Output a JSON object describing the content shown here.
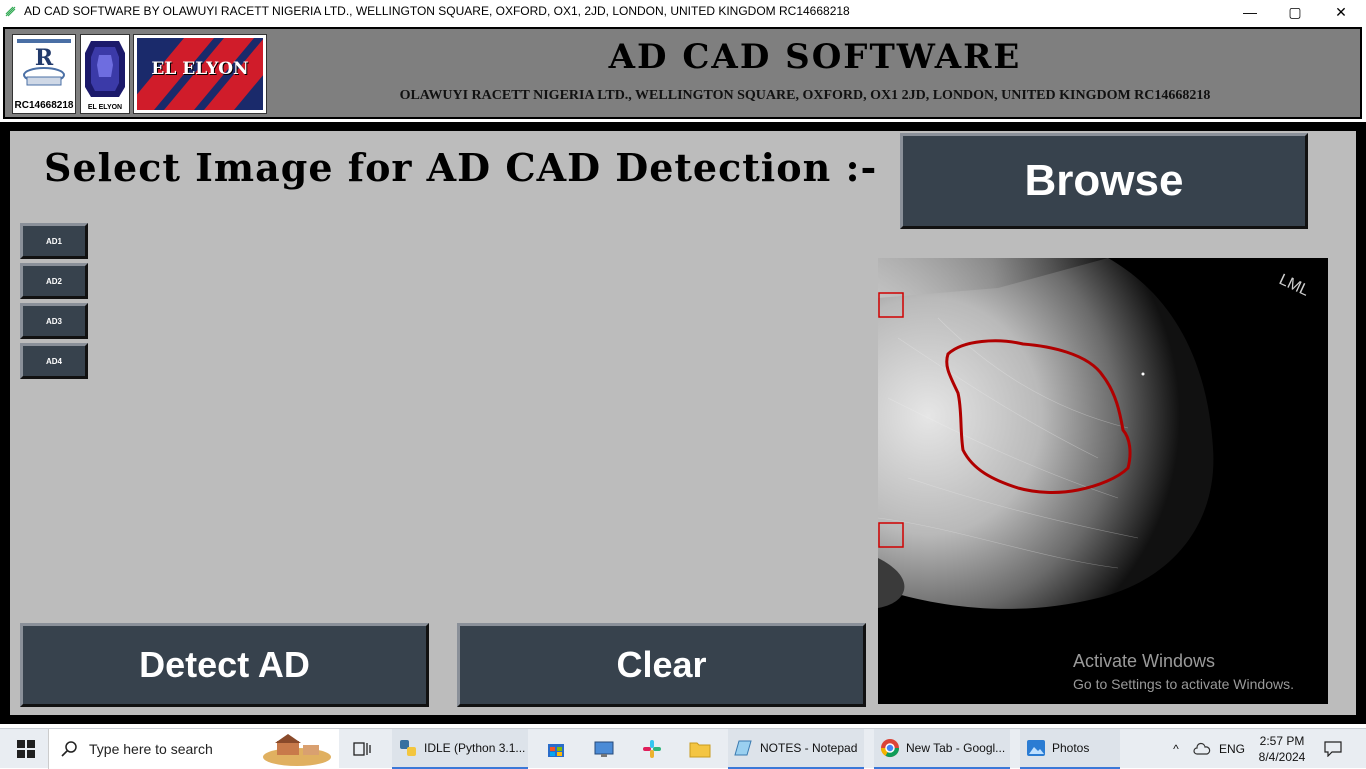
{
  "window": {
    "title": "AD CAD SOFTWARE BY OLAWUYI RACETT NIGERIA LTD., WELLINGTON SQUARE, OXFORD, OX1, 2JD, LONDON, UNITED KINGDOM RC14668218",
    "controls": {
      "minimize": "—",
      "maximize": "▢",
      "close": "✕"
    }
  },
  "header": {
    "title": "AD CAD SOFTWARE",
    "company_line": "OLAWUYI RACETT NIGERIA LTD., WELLINGTON SQUARE, OXFORD, OX1 2JD, LONDON, UNITED KINGDOM RC14668218",
    "logos": {
      "logo1_caption": "RC14668218",
      "logo2_caption": "EL ELYON",
      "logo3_text": "EL ELYON"
    }
  },
  "main": {
    "select_label": "Select Image for AD CAD Detection :-",
    "browse_label": "Browse",
    "ad_buttons": [
      "AD1",
      "AD2",
      "AD3",
      "AD4"
    ],
    "detect_label": "Detect AD",
    "clear_label": "Clear",
    "image": {
      "corner_text": "LML",
      "watermark_title": "Activate Windows",
      "watermark_sub": "Go to Settings to activate Windows."
    }
  },
  "taskbar": {
    "search_placeholder": "Type here to search",
    "apps": [
      {
        "label": "IDLE (Python 3.1...",
        "icon": "python-icon"
      },
      {
        "label": "NOTES - Notepad",
        "icon": "notepad-icon"
      },
      {
        "label": "New Tab - Googl...",
        "icon": "chrome-icon"
      },
      {
        "label": "Photos",
        "icon": "photos-icon"
      }
    ],
    "language": "ENG",
    "time": "2:57 PM",
    "date": "8/4/2024"
  },
  "colors": {
    "header_bg": "#7f7f7f",
    "panel_bg": "#bcbcbc",
    "button_bg": "#37424d",
    "contour": "#c00000"
  }
}
